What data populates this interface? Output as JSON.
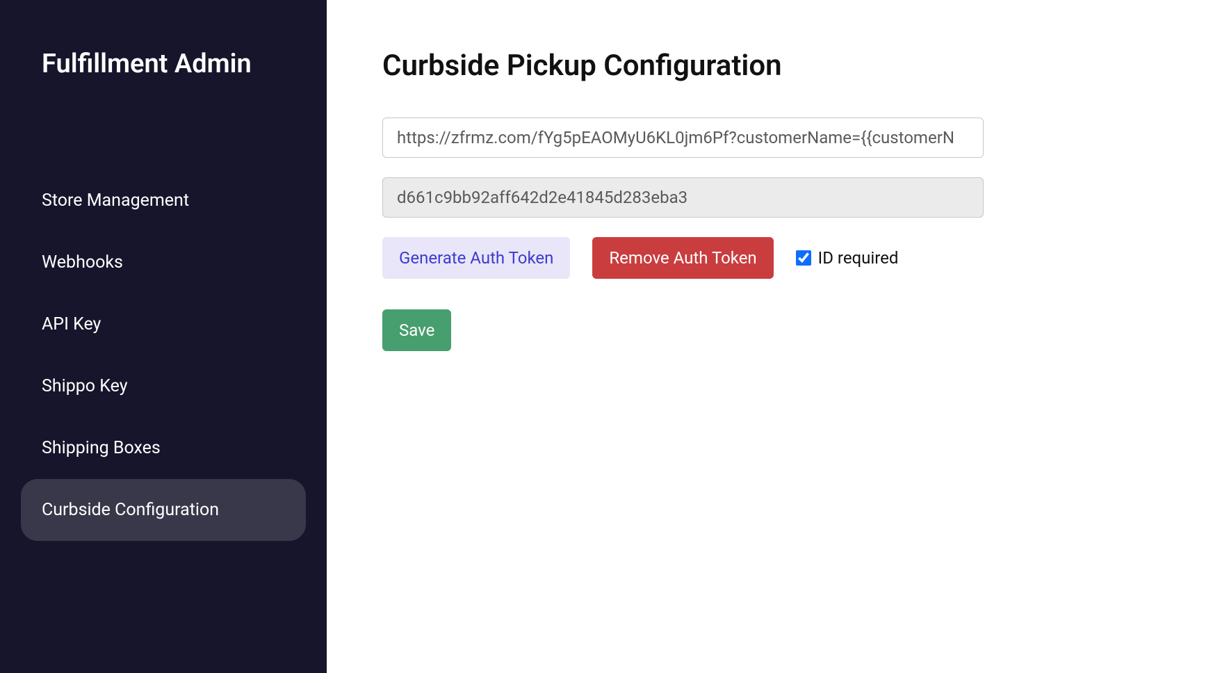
{
  "sidebar": {
    "title": "Fulfillment Admin",
    "items": [
      {
        "label": "Store Management",
        "active": false
      },
      {
        "label": "Webhooks",
        "active": false
      },
      {
        "label": "API Key",
        "active": false
      },
      {
        "label": "Shippo Key",
        "active": false
      },
      {
        "label": "Shipping Boxes",
        "active": false
      },
      {
        "label": "Curbside Configuration",
        "active": true
      }
    ]
  },
  "main": {
    "title": "Curbside Pickup Configuration",
    "url_input_value": "https://zfrmz.com/fYg5pEAOMyU6KL0jm6Pf?customerName={{customerN",
    "token_input_value": "d661c9bb92aff642d2e41845d283eba3",
    "generate_button_label": "Generate Auth Token",
    "remove_button_label": "Remove Auth Token",
    "id_required_label": "ID required",
    "id_required_checked": true,
    "save_button_label": "Save"
  }
}
